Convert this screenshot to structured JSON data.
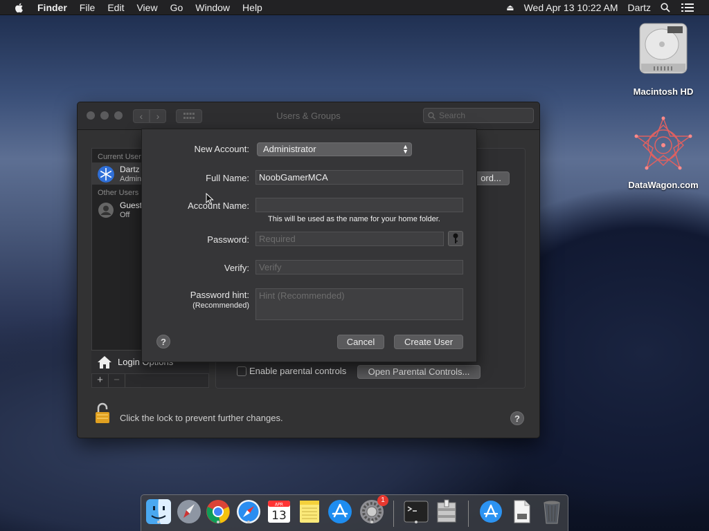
{
  "menubar": {
    "app": "Finder",
    "items": [
      "File",
      "Edit",
      "View",
      "Go",
      "Window",
      "Help"
    ],
    "datetime": "Wed Apr 13  10:22 AM",
    "user": "Dartz"
  },
  "desktop": {
    "icons": [
      {
        "label": "Macintosh HD",
        "icon": "hard-drive-icon"
      },
      {
        "label": "DataWagon.com",
        "icon": "datawagon-logo-icon"
      }
    ]
  },
  "window": {
    "title": "Users & Groups",
    "search_placeholder": "Search",
    "sidebar": {
      "current_users_header": "Current User",
      "current_user": {
        "name": "Dartz",
        "role": "Admin"
      },
      "other_users_header": "Other Users",
      "other_user": {
        "name": "Guest",
        "status": "Off"
      },
      "login_options": "Login Options"
    },
    "change_password_btn": "ord...",
    "parental_controls_label": "Enable parental controls",
    "open_parental_btn": "Open Parental Controls...",
    "lock_text": "Click the lock to prevent further changes.",
    "help": "?"
  },
  "sheet": {
    "new_account_label": "New Account:",
    "new_account_value": "Administrator",
    "full_name_label": "Full Name:",
    "full_name_value": "NoobGamerMCA",
    "account_name_label": "Account Name:",
    "account_name_value": "",
    "account_name_note": "This will be used as the name for your home folder.",
    "password_label": "Password:",
    "password_placeholder": "Required",
    "verify_label": "Verify:",
    "verify_placeholder": "Verify",
    "hint_label": "Password hint:",
    "hint_sublabel": "(Recommended)",
    "hint_placeholder": "Hint (Recommended)",
    "cancel": "Cancel",
    "create": "Create User",
    "help": "?"
  },
  "dock": {
    "calendar_month": "APR",
    "calendar_day": "13",
    "system_prefs_badge": "1",
    "items": [
      "finder-icon",
      "launchpad-icon",
      "chrome-icon",
      "safari-icon",
      "calendar-icon",
      "notes-icon",
      "app-store-icon",
      "system-preferences-icon",
      "terminal-icon",
      "archive-utility-icon",
      "app-store-downloads-icon",
      "document-icon",
      "trash-icon"
    ]
  },
  "colors": {
    "accent": "#3a3a3c",
    "badge": "#e8382f"
  }
}
